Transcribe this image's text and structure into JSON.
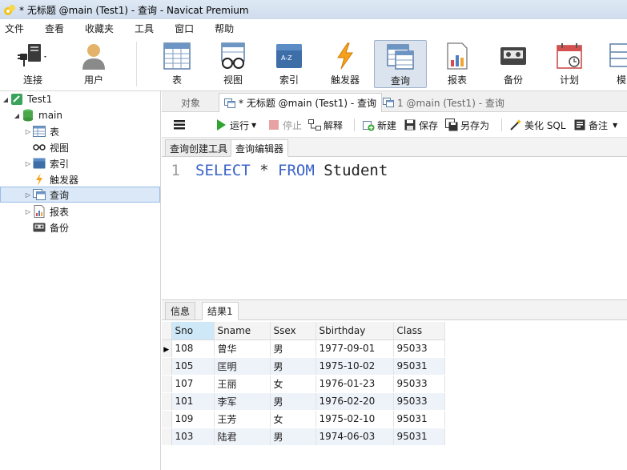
{
  "window": {
    "title": "* 无标题 @main (Test1) - 查询 - Navicat Premium"
  },
  "menu": [
    "文件",
    "查看",
    "收藏夹",
    "工具",
    "窗口",
    "帮助"
  ],
  "toolbar": {
    "connect": "连接",
    "user": "用户",
    "table": "表",
    "view": "视图",
    "index": "索引",
    "trigger": "触发器",
    "query": "查询",
    "report": "报表",
    "backup": "备份",
    "schedule": "计划",
    "model": "模"
  },
  "tree": {
    "connection": "Test1",
    "database": "main",
    "items": [
      "表",
      "视图",
      "索引",
      "触发器",
      "查询",
      "报表",
      "备份"
    ]
  },
  "object_tabs": {
    "objects": "对象",
    "tab1": "* 无标题 @main (Test1) - 查询",
    "tab2": "1 @main (Test1) - 查询"
  },
  "query_toolbar": {
    "run": "运行",
    "stop": "停止",
    "explain": "解释",
    "new": "新建",
    "save": "保存",
    "save_as": "另存为",
    "beautify": "美化 SQL",
    "comment": "备注"
  },
  "sub_tabs": {
    "builder": "查询创建工具",
    "editor": "查询编辑器"
  },
  "editor": {
    "line_number": "1",
    "kw_select": "SELECT",
    "star": "*",
    "kw_from": "FROM",
    "table_name": "Student"
  },
  "result_tabs": {
    "info": "信息",
    "result1": "结果1"
  },
  "result": {
    "columns": [
      "Sno",
      "Sname",
      "Ssex",
      "Sbirthday",
      "Class"
    ],
    "rows": [
      [
        "108",
        "曾华",
        "男",
        "1977-09-01",
        "95033"
      ],
      [
        "105",
        "匡明",
        "男",
        "1975-10-02",
        "95031"
      ],
      [
        "107",
        "王丽",
        "女",
        "1976-01-23",
        "95033"
      ],
      [
        "101",
        "李军",
        "男",
        "1976-02-20",
        "95033"
      ],
      [
        "109",
        "王芳",
        "女",
        "1975-02-10",
        "95031"
      ],
      [
        "103",
        "陆君",
        "男",
        "1974-06-03",
        "95031"
      ]
    ],
    "current_row_marker": "▶"
  }
}
